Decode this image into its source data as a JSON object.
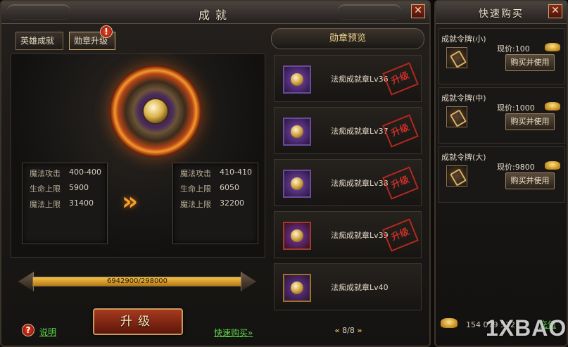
{
  "main_window": {
    "title": "成就",
    "close_label": "✕",
    "tabs": [
      {
        "label": "英雄成就",
        "active": false
      },
      {
        "label": "勋章升级",
        "active": true
      }
    ],
    "tab_badge": "!",
    "current_stats": [
      {
        "name": "魔法攻击",
        "value": "400-400"
      },
      {
        "name": "生命上限",
        "value": "5900"
      },
      {
        "name": "魔法上限",
        "value": "31400"
      }
    ],
    "next_stats": [
      {
        "name": "魔法攻击",
        "value": "410-410"
      },
      {
        "name": "生命上限",
        "value": "6050"
      },
      {
        "name": "魔法上限",
        "value": "32200"
      }
    ],
    "arrow_glyph": "»",
    "progress": {
      "text": "6942900/298000",
      "fill_fraction": 1.0
    },
    "help_icon": "?",
    "help_label": "说明",
    "upgrade_label": "升级",
    "quickbuy_label": "快速购买»"
  },
  "preview": {
    "title": "勋章预览",
    "items": [
      {
        "name": "法痴成就章Lv36",
        "stamp": "升级"
      },
      {
        "name": "法痴成就章Lv37",
        "stamp": "升级"
      },
      {
        "name": "法痴成就章Lv38",
        "stamp": "升级"
      },
      {
        "name": "法痴成就章Lv39",
        "stamp": "升级"
      },
      {
        "name": "法痴成就章Lv40",
        "stamp": ""
      }
    ],
    "pager": {
      "prev": "«",
      "text": "8/8",
      "next": "»"
    }
  },
  "quick_buy": {
    "title": "快速购买",
    "close_label": "✕",
    "items": [
      {
        "name": "成就令牌(小)",
        "price": "现价:100",
        "button": "购买并使用"
      },
      {
        "name": "成就令牌(中)",
        "price": "现价:1000",
        "button": "购买并使用"
      },
      {
        "name": "成就令牌(大)",
        "price": "现价:9800",
        "button": "购买并使用"
      }
    ],
    "currency_value": "154 079 532",
    "recharge_label": "充值"
  },
  "watermark": "1XBAO",
  "colors": {
    "accent_gold": "#f0d48a",
    "link_green": "#5ad24a",
    "button_red": "#a63a1e",
    "stamp_red": "#d8322a"
  },
  "icons": [
    "close-icon",
    "medal-emblem-icon",
    "double-arrow-icon",
    "help-icon",
    "token-icon",
    "gold-ingot-icon",
    "page-prev-icon",
    "page-next-icon"
  ]
}
